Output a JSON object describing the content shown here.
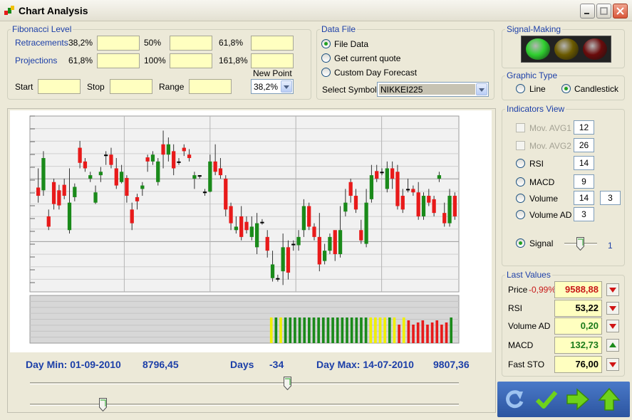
{
  "window": {
    "title": "Chart Analysis"
  },
  "fibonacci": {
    "legend": "Fibonacci Level",
    "retracements_label": "Retracements",
    "retracement_levels": [
      "38,2%",
      "50%",
      "61,8%"
    ],
    "projections_label": "Projections",
    "projection_levels": [
      "61,8%",
      "100%",
      "161,8%"
    ],
    "start_label": "Start",
    "stop_label": "Stop",
    "range_label": "Range",
    "new_point_label": "New Point",
    "new_point_value": "38,2%"
  },
  "data_file": {
    "legend": "Data File",
    "options": [
      "File Data",
      "Get current quote",
      "Custom Day Forecast"
    ],
    "selected": 0,
    "select_symbol_label": "Select Symbol",
    "symbol": "NIKKEI225"
  },
  "signal_making": {
    "legend": "Signal-Making",
    "lights": [
      "#2fcf2f",
      "#6b5a00",
      "#6a0b0b"
    ],
    "active": "green"
  },
  "graphic_type": {
    "legend": "Graphic Type",
    "options": [
      "Line",
      "Candlestick"
    ],
    "selected": 1
  },
  "indicators": {
    "legend": "Indicators View",
    "items": [
      {
        "label": "Mov. AVG1",
        "control": "checkbox",
        "enabled": false,
        "value": "12"
      },
      {
        "label": "Mov. AVG2",
        "control": "checkbox",
        "enabled": false,
        "value": "26"
      },
      {
        "label": "RSI",
        "control": "radio",
        "value": "14"
      },
      {
        "label": "MACD",
        "control": "radio",
        "value": "9"
      },
      {
        "label": "Volume",
        "control": "radio",
        "value": "14",
        "value2": "3"
      },
      {
        "label": "Volume AD",
        "control": "radio",
        "value": "3"
      }
    ],
    "signal_label": "Signal",
    "signal_value": "1"
  },
  "last_values": {
    "legend": "Last Values",
    "price_label": "Price",
    "price_change": "-0,99%",
    "items": [
      {
        "label": "Price",
        "value": "9588,88",
        "trend": "down"
      },
      {
        "label": "RSI",
        "value": "53,22",
        "trend": "down"
      },
      {
        "label": "Volume AD",
        "value": "0,20",
        "trend": "down"
      },
      {
        "label": "MACD",
        "value": "132,73",
        "trend": "up"
      },
      {
        "label": "Fast STO",
        "value": "76,00",
        "trend": "down"
      }
    ]
  },
  "stats": {
    "day_min": "Day Min: 01-09-2010",
    "min_value": "8796,45",
    "days_label": "Days",
    "days_value": "-34",
    "day_max": "Day Max: 14-07-2010",
    "max_value": "9807,36"
  },
  "sliders": {
    "upper_position": 0.6,
    "lower_position": 0.17,
    "signal_position": 0.5
  },
  "colors": {
    "up_candle": "#1a8a1a",
    "down_candle": "#e81a1a",
    "accent_blue": "#1c3fa8"
  },
  "chart_data": {
    "type": "candlestick",
    "candles": [
      [
        162,
        150,
        140,
        190
      ],
      [
        158,
        205,
        150,
        215
      ],
      [
        120,
        105,
        100,
        130
      ],
      [
        170,
        138,
        130,
        175
      ],
      [
        158,
        136,
        130,
        166
      ],
      [
        166,
        150,
        145,
        175
      ],
      [
        100,
        140,
        95,
        190
      ],
      [
        148,
        163,
        142,
        168
      ],
      [
        220,
        198,
        190,
        230
      ],
      [
        200,
        190,
        185,
        205
      ],
      [
        175,
        180,
        170,
        185
      ],
      [
        140,
        155,
        138,
        165
      ],
      [
        180,
        185,
        170,
        192
      ],
      [
        210,
        208,
        195,
        215
      ],
      [
        210,
        195,
        190,
        220
      ],
      [
        190,
        165,
        160,
        205
      ],
      [
        170,
        185,
        168,
        195
      ],
      [
        176,
        150,
        140,
        180
      ],
      [
        130,
        110,
        100,
        140
      ],
      [
        148,
        142,
        130,
        153
      ],
      [
        160,
        165,
        150,
        170
      ],
      [
        206,
        200,
        185,
        210
      ],
      [
        200,
        210,
        195,
        215
      ],
      [
        170,
        200,
        165,
        205
      ],
      [
        225,
        210,
        190,
        245
      ],
      [
        210,
        225,
        200,
        235
      ],
      [
        215,
        190,
        180,
        225
      ],
      [
        200,
        200,
        195,
        205
      ],
      [
        220,
        215,
        208,
        225
      ],
      [
        210,
        205,
        200,
        218
      ],
      [
        175,
        180,
        160,
        185
      ],
      [
        178,
        180,
        175,
        180
      ],
      [
        156,
        155,
        150,
        160
      ],
      [
        156,
        200,
        155,
        210
      ],
      [
        200,
        185,
        180,
        225
      ],
      [
        190,
        180,
        175,
        205
      ],
      [
        175,
        130,
        120,
        180
      ],
      [
        135,
        110,
        100,
        140
      ],
      [
        100,
        105,
        95,
        120
      ],
      [
        120,
        90,
        85,
        135
      ],
      [
        112,
        100,
        95,
        120
      ],
      [
        90,
        105,
        85,
        120
      ],
      [
        75,
        110,
        65,
        125
      ],
      [
        112,
        110,
        108,
        116
      ],
      [
        90,
        70,
        60,
        100
      ],
      [
        30,
        50,
        25,
        70
      ],
      [
        30,
        30,
        25,
        35
      ],
      [
        40,
        75,
        20,
        95
      ],
      [
        75,
        38,
        28,
        85
      ],
      [
        78,
        80,
        70,
        85
      ],
      [
        78,
        90,
        70,
        100
      ],
      [
        100,
        135,
        90,
        145
      ],
      [
        135,
        105,
        100,
        140
      ],
      [
        105,
        90,
        85,
        110
      ],
      [
        90,
        50,
        40,
        125
      ],
      [
        55,
        70,
        50,
        80
      ],
      [
        70,
        90,
        65,
        95
      ],
      [
        100,
        65,
        55,
        95
      ],
      [
        65,
        100,
        60,
        135
      ],
      [
        127,
        140,
        120,
        160
      ],
      [
        170,
        150,
        140,
        175
      ],
      [
        150,
        130,
        125,
        160
      ],
      [
        100,
        85,
        80,
        115
      ],
      [
        80,
        140,
        75,
        160
      ],
      [
        145,
        180,
        140,
        195
      ],
      [
        186,
        175,
        170,
        195
      ],
      [
        185,
        185,
        180,
        190
      ],
      [
        160,
        190,
        155,
        200
      ],
      [
        190,
        175,
        160,
        200
      ],
      [
        185,
        135,
        130,
        195
      ],
      [
        150,
        130,
        125,
        160
      ],
      [
        160,
        160,
        155,
        175
      ],
      [
        160,
        155,
        150,
        165
      ],
      [
        155,
        120,
        115,
        170
      ],
      [
        120,
        150,
        115,
        155
      ],
      [
        150,
        140,
        135,
        160
      ],
      [
        145,
        125,
        120,
        150
      ],
      [
        175,
        180,
        170,
        185
      ],
      [
        125,
        110,
        105,
        140
      ],
      [
        110,
        150,
        105,
        160
      ],
      [
        150,
        120,
        115,
        155
      ]
    ],
    "volume_colors": [
      "y",
      "g",
      "y",
      "g",
      "g",
      "g",
      "g",
      "g",
      "g",
      "g",
      "g",
      "g",
      "g",
      "g",
      "g",
      "g",
      "g",
      "g",
      "g",
      "g",
      "g",
      "y",
      "y",
      "y",
      "y",
      "g",
      "y",
      "r",
      "y",
      "r",
      "r",
      "r",
      "r",
      "r",
      "r",
      "r",
      "r",
      "r",
      "g"
    ],
    "grid": true
  }
}
